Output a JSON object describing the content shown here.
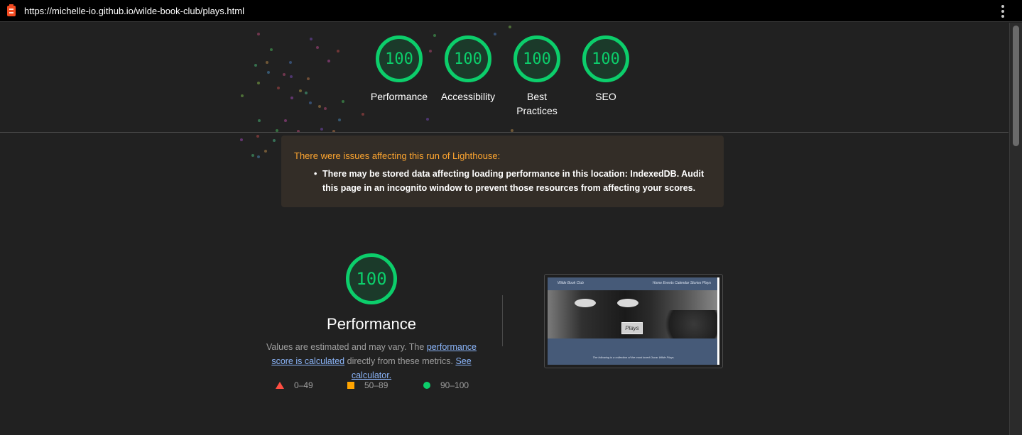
{
  "browser": {
    "url": "https://michelle-io.github.io/wilde-book-club/plays.html",
    "logo_icon": "lighthouse-icon",
    "menu_icon": "kebab-menu-icon"
  },
  "scores": [
    {
      "label": "Performance",
      "score": "100"
    },
    {
      "label": "Accessibility",
      "score": "100"
    },
    {
      "label": "Best Practices",
      "score": "100"
    },
    {
      "label": "SEO",
      "score": "100"
    }
  ],
  "warning": {
    "title": "There were issues affecting this run of Lighthouse:",
    "items": [
      "There may be stored data affecting loading performance in this location: IndexedDB. Audit this page in an incognito window to prevent those resources from affecting your scores."
    ]
  },
  "performance": {
    "score": "100",
    "title": "Performance",
    "desc_prefix": "Values are estimated and may vary. The ",
    "desc_link1": "performance score is calculated",
    "desc_middle": " directly from these metrics. ",
    "desc_link2": "See calculator."
  },
  "legend": [
    {
      "shape": "triangle",
      "label": "0–49",
      "color": "#ff4e42"
    },
    {
      "shape": "square",
      "label": "50–89",
      "color": "#ffa400"
    },
    {
      "shape": "circle",
      "label": "90–100",
      "color": "#0cce6b"
    }
  ],
  "thumbnail": {
    "brand": "Wilde Book Club",
    "nav": "Home  Events  Calendar  Stories  Plays",
    "badge": "Plays",
    "caption": "The following is a collection of the most loved Oscar Wilde Plays."
  },
  "colors": {
    "pass": "#0cce6b",
    "average": "#ffa400",
    "fail": "#ff4e42",
    "warning": "#ffa630",
    "link": "#8ab4f8",
    "background": "#212121"
  }
}
